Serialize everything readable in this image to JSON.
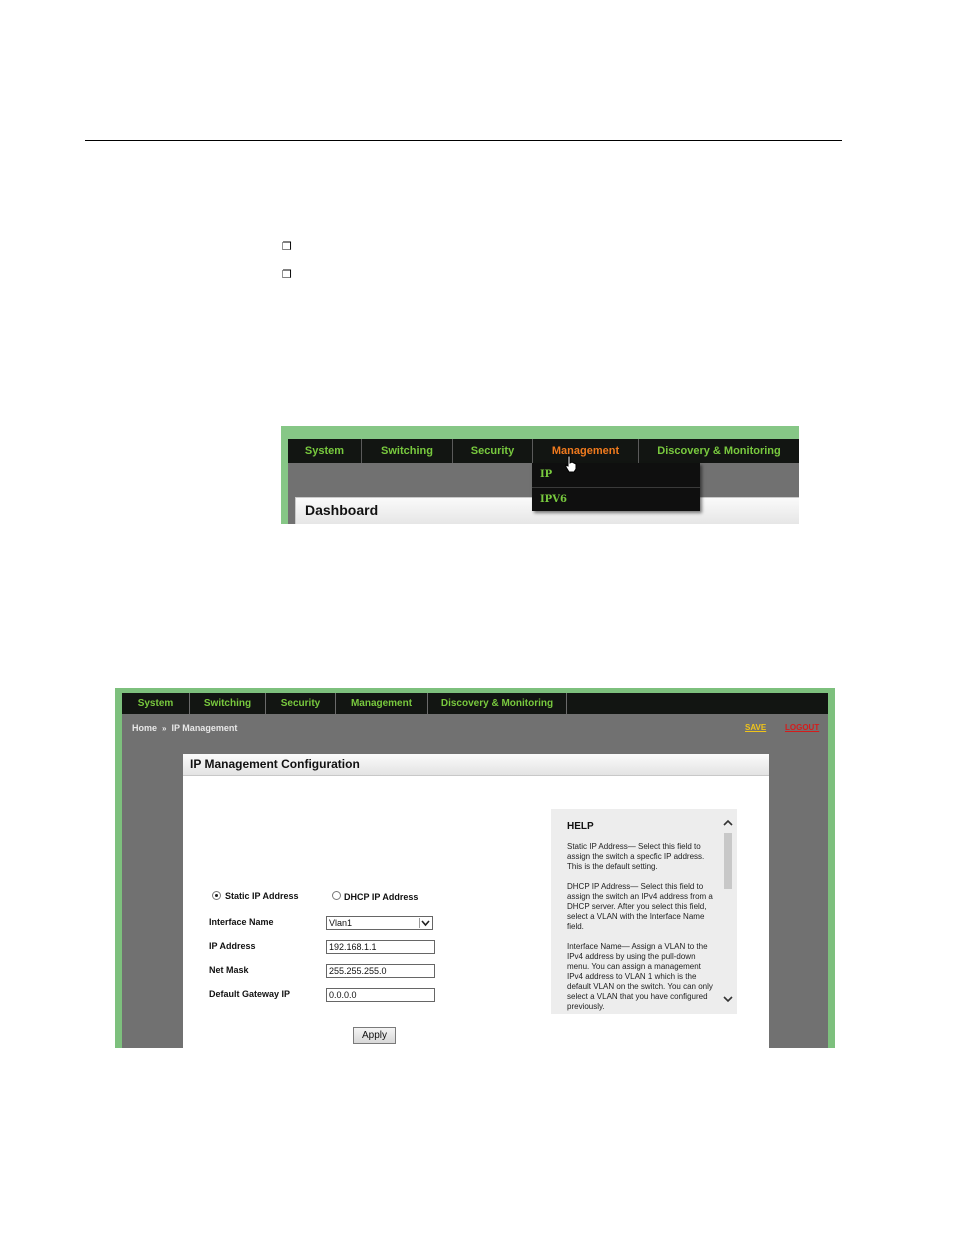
{
  "page": {
    "bullet_glyphs": [
      "❐",
      "❐"
    ]
  },
  "screenshot1": {
    "menu": [
      "System",
      "Switching",
      "Security",
      "Management",
      "Discovery & Monitoring"
    ],
    "active_menu": "Management",
    "dropdown_items": [
      "IP",
      "IPV6"
    ],
    "panel_title": "Dashboard"
  },
  "screenshot2": {
    "menu": [
      "System",
      "Switching",
      "Security",
      "Management",
      "Discovery & Monitoring"
    ],
    "breadcrumb": {
      "home": "Home",
      "separator": "»",
      "current": "IP Management"
    },
    "save_label": "SAVE",
    "logout_label": "LOGOUT",
    "panel_title": "IP Management Configuration",
    "static_ip_label": "Static IP Address",
    "dhcp_ip_label": "DHCP IP Address",
    "selected_mode": "Static IP Address",
    "fields": {
      "interface_name_label": "Interface Name",
      "interface_name_value": "Vlan1",
      "ip_address_label": "IP Address",
      "ip_address_value": "192.168.1.1",
      "net_mask_label": "Net Mask",
      "net_mask_value": "255.255.255.0",
      "gateway_label": "Default Gateway IP",
      "gateway_value": "0.0.0.0"
    },
    "apply_label": "Apply",
    "help": {
      "title": "HELP",
      "paragraphs": [
        "Static IP Address— Select this field to assign the switch a specfic IP address. This is the default setting.",
        "DHCP IP Address— Select this field to assign the switch an IPv4 address from a DHCP server. After you select this field, select a VLAN with the Interface Name field.",
        "Interface Name— Assign a VLAN to the IPv4 address by using the pull-down menu. You can assign a management IPv4 address to VLAN 1 which is the default VLAN on the switch. You can only select a VLAN that you have configured previously."
      ]
    }
  },
  "colors": {
    "menu_green": "#78c93e",
    "menu_active_orange": "#f07a1e",
    "frame_green": "#86c786",
    "save_yellow": "#f0c419",
    "logout_red": "#d51c1c"
  }
}
